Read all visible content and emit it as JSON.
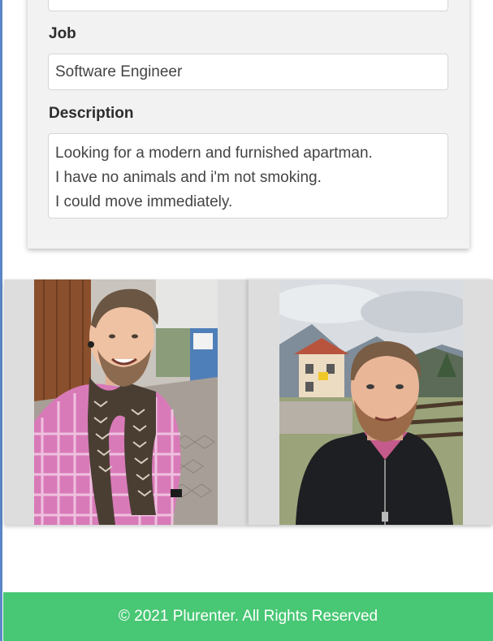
{
  "form": {
    "job_label": "Job",
    "job_value": "Software Engineer",
    "description_label": "Description",
    "description_lines": [
      "Looking for a modern and furnished apartman.",
      "I have no animals and i'm not smoking.",
      "I could move immediately."
    ]
  },
  "gallery": {
    "photos": [
      {
        "subject": "selfie of man in pink checked shirt and scarf"
      },
      {
        "subject": "selfie of man in black jacket with mountains behind"
      }
    ]
  },
  "footer": {
    "text": "© 2021 Plurenter. All Rights Reserved",
    "background_color": "#48c774"
  }
}
